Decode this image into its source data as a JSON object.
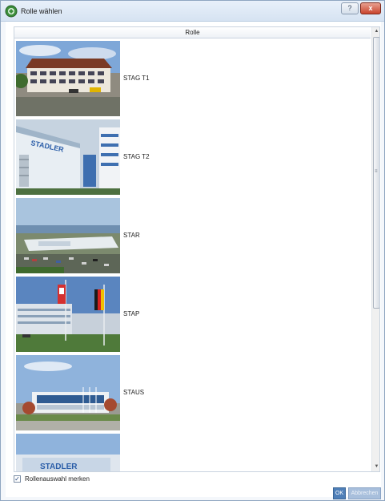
{
  "window": {
    "title": "Rolle wählen",
    "help_label": "?",
    "close_label": "x"
  },
  "list": {
    "column_header": "Rolle",
    "rows": [
      {
        "label": "STAG T1",
        "image": "building-photo"
      },
      {
        "label": "STAG T2",
        "image": "building-photo"
      },
      {
        "label": "STAR",
        "image": "building-photo"
      },
      {
        "label": "STAP",
        "image": "building-photo"
      },
      {
        "label": "STAUS",
        "image": "building-photo"
      },
      {
        "label": "",
        "image": "building-photo"
      }
    ],
    "sign_text": "STADLER",
    "sign_text_partial": "STADLER"
  },
  "remember": {
    "label": "Rollenauswahl merken",
    "checked": true
  },
  "buttons": {
    "ok": "OK",
    "cancel": "Abbrechen"
  },
  "colors": {
    "titlebar": "#d6e3f2",
    "close": "#c9442d",
    "ok": "#4f7fb8",
    "cancel": "#a8bfdc"
  }
}
